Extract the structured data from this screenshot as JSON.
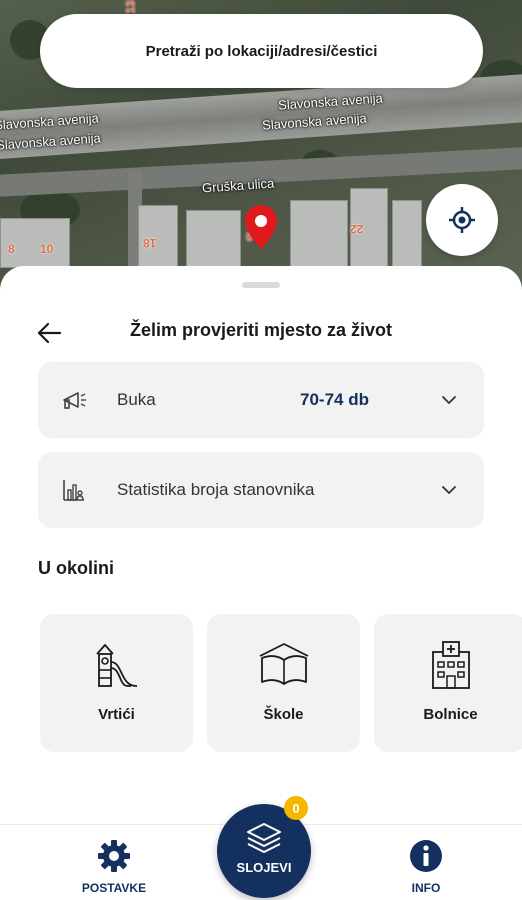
{
  "map": {
    "street_labels": [
      "Slavonska avenija",
      "Slavonska avenija",
      "Slavonska avenija",
      "Slavonska avenija",
      "Gruška ulica"
    ],
    "house_numbers": [
      "18",
      "0",
      "22",
      "10",
      "8",
      "13"
    ]
  },
  "search": {
    "placeholder": "Pretraži po lokaciji/adresi/čestici"
  },
  "sheet": {
    "title": "Želim provjeriti mjesto za život",
    "rows": [
      {
        "label": "Buka",
        "value": "70-74 db",
        "icon": "megaphone-icon"
      },
      {
        "label": "Statistika broja stanovnika",
        "value": "",
        "icon": "population-chart-icon"
      }
    ],
    "section_title": "U okolini",
    "cards": [
      {
        "label": "Vrtići",
        "icon": "playground-icon"
      },
      {
        "label": "Škole",
        "icon": "book-icon"
      },
      {
        "label": "Bolnice",
        "icon": "hospital-icon"
      }
    ]
  },
  "nav": {
    "settings_label": "POSTAVKE",
    "layers_label": "SLOJEVI",
    "layers_badge": "0",
    "info_label": "INFO"
  },
  "colors": {
    "primary": "#14305e",
    "badge": "#f5b800",
    "pin": "#e0191e",
    "card_bg": "#f2f2f2"
  }
}
